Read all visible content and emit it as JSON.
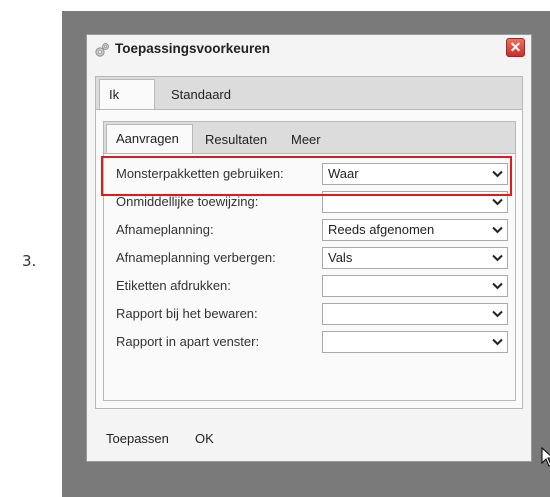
{
  "step_label": "3.",
  "dialog": {
    "title": "Toepassingsvoorkeuren",
    "close_label": "✕",
    "outer_tabs": [
      "Ik",
      "Standaard"
    ],
    "inner_tabs": [
      "Aanvragen",
      "Resultaten",
      "Meer"
    ],
    "rows": [
      {
        "label": "Monsterpakketten gebruiken:",
        "value": "Waar"
      },
      {
        "label": "Onmiddellijke toewijzing:",
        "value": ""
      },
      {
        "label": "Afnameplanning:",
        "value": "Reeds afgenomen"
      },
      {
        "label": "Afnameplanning verbergen:",
        "value": "Vals"
      },
      {
        "label": "Etiketten afdrukken:",
        "value": ""
      },
      {
        "label": "Rapport bij het bewaren:",
        "value": ""
      },
      {
        "label": "Rapport in apart venster:",
        "value": ""
      }
    ],
    "footer": {
      "apply_label": "Toepassen",
      "ok_label": "OK"
    }
  },
  "colors": {
    "highlight": "#dd1c1c",
    "close_button": "#c9302a",
    "backdrop": "#7a7a7a"
  }
}
